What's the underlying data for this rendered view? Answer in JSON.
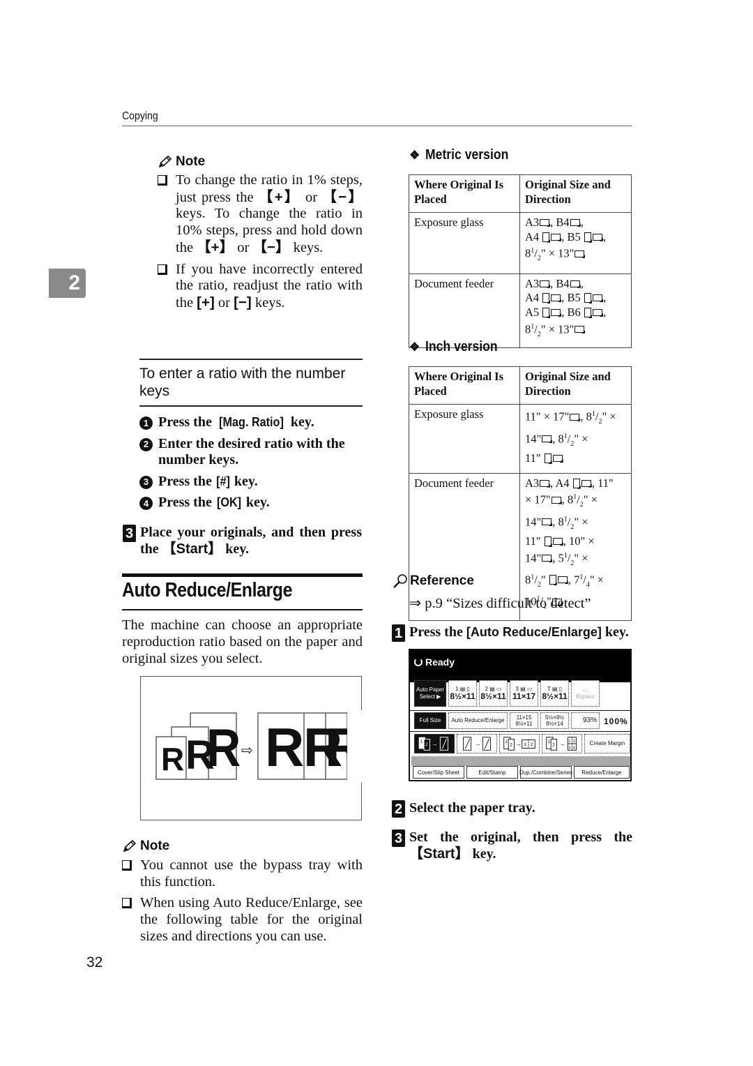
{
  "header": {
    "running_head": "Copying"
  },
  "chapter_tab": "2",
  "page_number": "32",
  "left_column": {
    "note1": {
      "title": "Note",
      "items": [
        {
          "parts": [
            "To change the ratio in 1% steps, just press the ",
            "【+】",
            " or ",
            "【−】",
            " keys. To change the ratio in 10% steps, press and hold down the ",
            "【+】",
            " or ",
            "【−】",
            " keys."
          ]
        },
        {
          "parts": [
            "If you have incorrectly entered the ratio, readjust the ratio with the ",
            "[+]",
            " or ",
            "[−]",
            " keys."
          ]
        }
      ]
    },
    "subsection_title": "To enter a ratio with the number keys",
    "substeps": [
      {
        "num": "1",
        "before": "Press the ",
        "key": "[Mag. Ratio]",
        "after": " key."
      },
      {
        "num": "2",
        "before": "Enter the desired ratio with the number keys.",
        "key": "",
        "after": ""
      },
      {
        "num": "3",
        "before": "Press the ",
        "key": "[#]",
        "after": " key."
      },
      {
        "num": "4",
        "before": "Press the ",
        "key": "[OK]",
        "after": " key."
      }
    ],
    "step3": {
      "num": "3",
      "before": "Place your originals, and then press the ",
      "key": "【Start】",
      "after": " key."
    },
    "section_title": "Auto Reduce/Enlarge",
    "section_body": "The machine can choose an appropriate reproduction ratio based on the paper and original sizes you select.",
    "figure": {
      "letter": "R",
      "arrow": "⇨"
    },
    "note2": {
      "title": "Note",
      "items": [
        "You cannot use the bypass tray with this function.",
        "When using Auto Reduce/Enlarge, see the following table for the original sizes and directions you can use."
      ]
    }
  },
  "right_column": {
    "metric": {
      "title": "Metric version",
      "headers": [
        "Where Original Is Placed",
        "Original Size and Direction"
      ],
      "rows": [
        {
          "place": "Exposure glass",
          "sizes": "A3▭, B4▭, A4▯▭, B5▯▭, 8½\" × 13\"▭"
        },
        {
          "place": "Document feeder",
          "sizes": "A3▭, B4▭, A4▯▭, B5▯▭, A5▯▭, B6▯▭, 8½\" × 13\"▭"
        }
      ]
    },
    "inch": {
      "title": "Inch version",
      "headers": [
        "Where Original Is Placed",
        "Original Size and Direction"
      ],
      "rows": [
        {
          "place": "Exposure glass",
          "sizes": "11\" × 17\"▭, 8½\" × 14\"▭, 8½\" × 11\"▯▭"
        },
        {
          "place": "Document feeder",
          "sizes": "A3▭, A4▯▭, 11\" × 17\"▭, 8½\" × 14\"▭, 8½\" × 11\"▯▭, 10\" × 14\"▭, 5½\" × 8½\"▯▭, 7¼\" × 10½\"▭"
        }
      ]
    },
    "reference": {
      "title": "Reference",
      "text": "⇒ p.9 “Sizes difficult to detect”"
    },
    "step1": {
      "num": "1",
      "before": "Press the ",
      "key": "[Auto Reduce/Enlarge]",
      "after": " key."
    },
    "panel": {
      "status": "Ready",
      "row1": [
        {
          "label": "Auto Paper Select ▶",
          "dark": true
        },
        {
          "top": "1 ▤ ▯",
          "main": "8½×11"
        },
        {
          "top": "2 ▤ ▭",
          "main": "8½×11"
        },
        {
          "top": "3 ▤ ▭",
          "main": "11×17"
        },
        {
          "top": "T ▤ ▯",
          "main": "8½×11"
        },
        {
          "top": "▭",
          "main": "Bypass",
          "faint": true
        }
      ],
      "row2": [
        {
          "label": "Full Size",
          "dark": true
        },
        {
          "label": "Auto Reduce/Enlarge"
        },
        {
          "top": "11×15",
          "main": "8½×11"
        },
        {
          "top": "5½×8½",
          "main": "8½×14"
        },
        {
          "label": "93%"
        }
      ],
      "ratio": "100%",
      "row3": [
        {
          "label": "1-sided to 2-sided",
          "dark": true
        },
        {
          "label": "2-sided to 2-sided"
        },
        {
          "label": "Combine 2 originals"
        },
        {
          "label": "Combine 4 originals"
        },
        {
          "label": "Create Margin"
        }
      ],
      "tabs": [
        "Cover/Slip Sheet",
        "Edit/Stamp",
        "Dup./Combine/Series",
        "Reduce/Enlarge"
      ]
    },
    "step2": {
      "num": "2",
      "text": "Select the paper tray."
    },
    "step3": {
      "num": "3",
      "before": "Set the original, then press the ",
      "key": "【Start】",
      "after": " key."
    }
  }
}
